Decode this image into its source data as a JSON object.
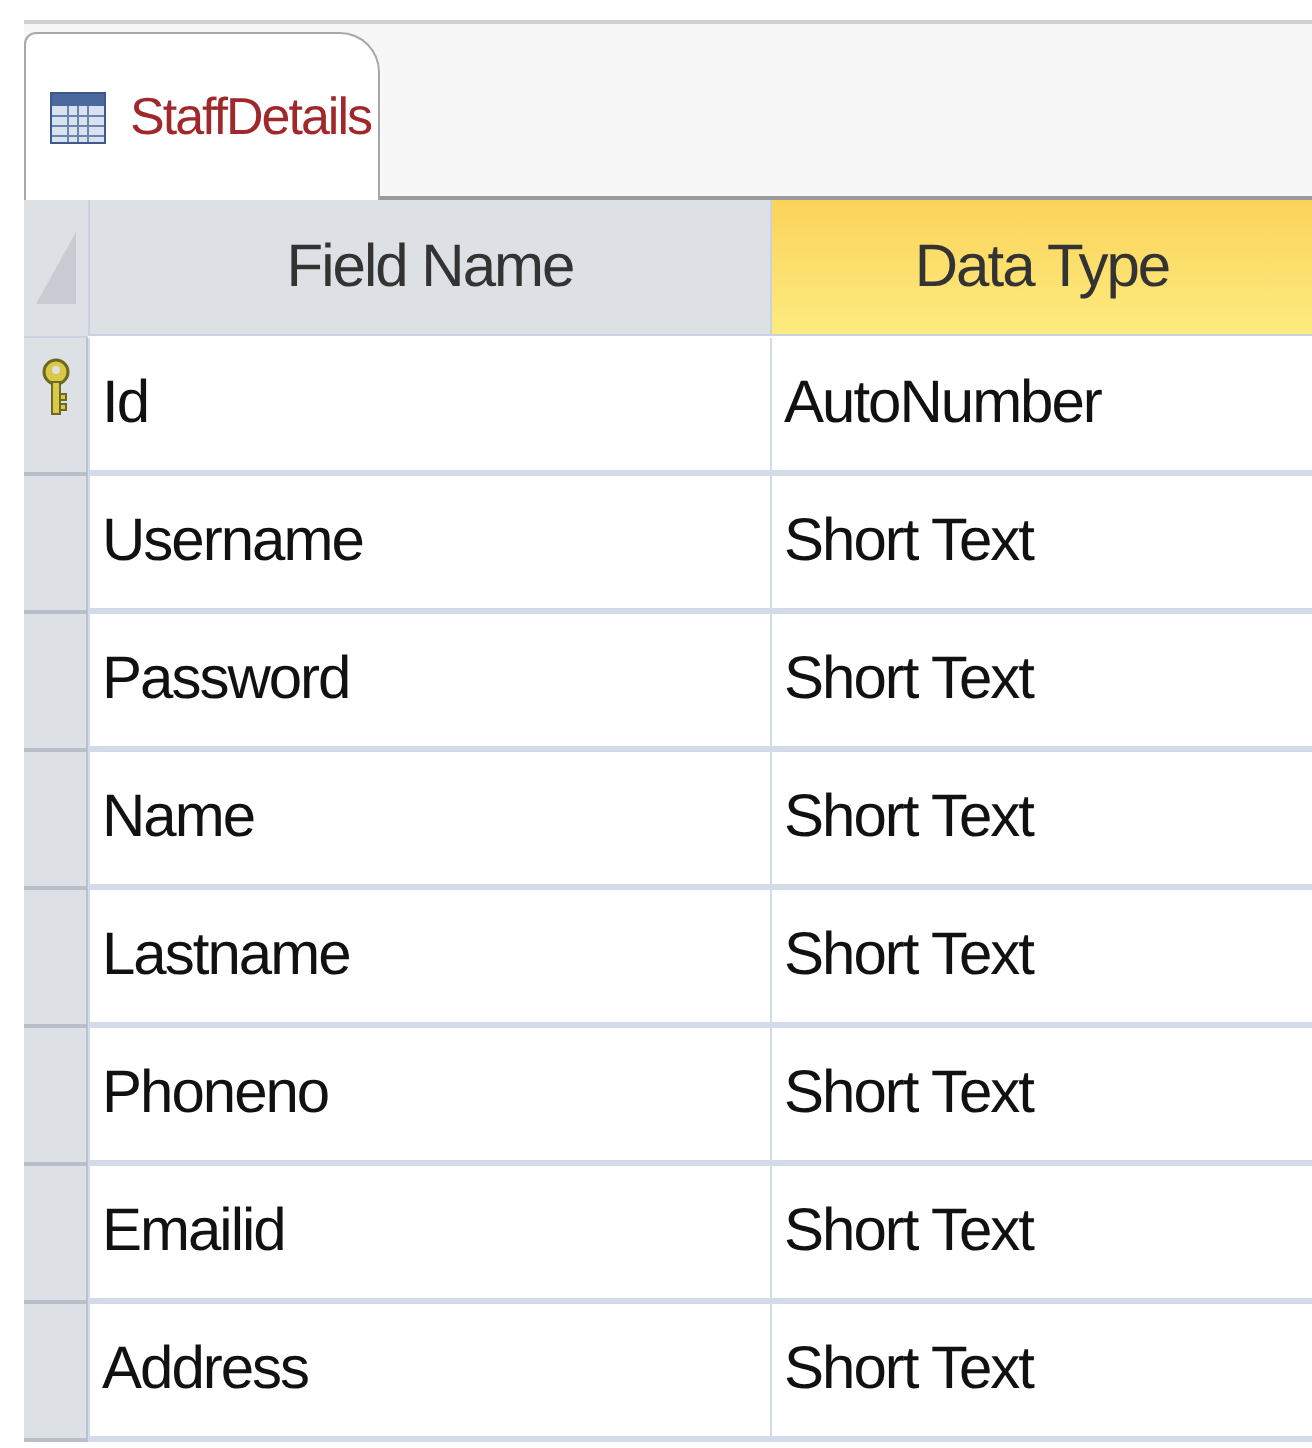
{
  "tab": {
    "title": "StaffDetails",
    "selected": true
  },
  "columns": [
    {
      "label": "Field Name",
      "selected": false
    },
    {
      "label": "Data Type",
      "selected": true
    }
  ],
  "rows": [
    {
      "field": "Id",
      "type": "AutoNumber",
      "primary_key": true
    },
    {
      "field": "Username",
      "type": "Short Text",
      "primary_key": false
    },
    {
      "field": "Password",
      "type": "Short Text",
      "primary_key": false
    },
    {
      "field": "Name",
      "type": "Short Text",
      "primary_key": false
    },
    {
      "field": "Lastname",
      "type": "Short Text",
      "primary_key": false
    },
    {
      "field": "Phoneno",
      "type": "Short Text",
      "primary_key": false
    },
    {
      "field": "Emailid",
      "type": "Short Text",
      "primary_key": false
    },
    {
      "field": "Address",
      "type": "Short Text",
      "primary_key": false
    }
  ]
}
